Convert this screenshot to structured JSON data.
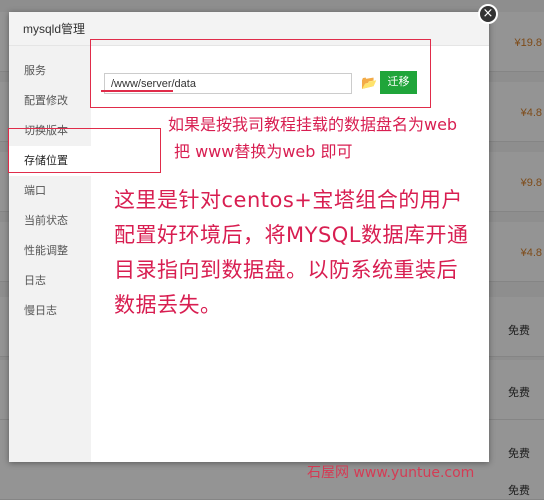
{
  "dialog": {
    "title": "mysqld管理",
    "close_symbol": "×"
  },
  "sidebar": {
    "items": [
      {
        "label": "服务"
      },
      {
        "label": "配置修改"
      },
      {
        "label": "切换版本"
      },
      {
        "label": "存储位置"
      },
      {
        "label": "端口"
      },
      {
        "label": "当前状态"
      },
      {
        "label": "性能调整"
      },
      {
        "label": "日志"
      },
      {
        "label": "慢日志"
      }
    ],
    "active_index": 3
  },
  "storage": {
    "path_value": "/www/server/data",
    "folder_icon": "folder-open-icon",
    "migrate_label": "迁移"
  },
  "annotations": {
    "note_line1": "如果是按我司教程挂载的数据盘名为web",
    "note_line2": "把 www替换为web 即可",
    "desc_line1": "这里是针对centos+宝塔组合的用户",
    "desc_line2": "配置好环境后，将MYSQL数据库开通",
    "desc_line3": "目录指向到数据盘。以防系统重装后",
    "desc_line4": "数据丢失。"
  },
  "background": {
    "prices": [
      "¥19.8",
      "¥4.8",
      "¥9.8",
      "¥4.8"
    ],
    "free_labels": [
      "免费",
      "免费",
      "免费",
      "免费"
    ]
  },
  "watermark": "石屋网 www.yuntue.com",
  "colors": {
    "accent_green": "#20a53a",
    "annotation_red": "#d81e51",
    "price_orange": "#d9822b"
  }
}
